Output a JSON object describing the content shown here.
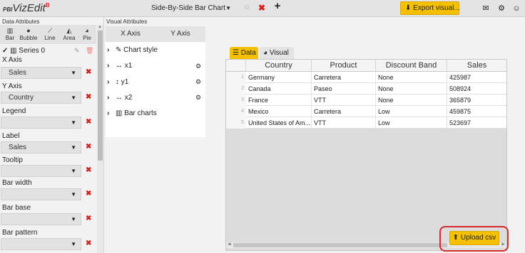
{
  "app": {
    "logo_prefix": "PBI",
    "logo_name": "VizEdit",
    "logo_badge": "B"
  },
  "toolbar": {
    "chart_type_selected": "Side-By-Side Bar Chart",
    "export_label": "Export visual..."
  },
  "data_attributes": {
    "title": "Data Attributes",
    "chart_types": [
      {
        "label": "Bar",
        "icon": "bar-chart-icon"
      },
      {
        "label": "Bubble",
        "icon": "bubble-chart-icon"
      },
      {
        "label": "Line",
        "icon": "line-chart-icon"
      },
      {
        "label": "Area",
        "icon": "area-chart-icon"
      },
      {
        "label": "Pie",
        "icon": "pie-chart-icon"
      }
    ],
    "series_label": "Series 0",
    "fields": [
      {
        "label": "X Axis",
        "value": "Sales"
      },
      {
        "label": "Y Axis",
        "value": "Country"
      },
      {
        "label": "Legend",
        "value": ""
      },
      {
        "label": "Label",
        "value": "Sales"
      },
      {
        "label": "Tooltip",
        "value": ""
      },
      {
        "label": "Bar width",
        "value": ""
      },
      {
        "label": "Bar base",
        "value": ""
      },
      {
        "label": "Bar pattern",
        "value": ""
      }
    ]
  },
  "visual_attributes": {
    "title": "Visual Attributes",
    "tabs": [
      "X Axis",
      "Y Axis"
    ],
    "tree": [
      {
        "label": "Chart style"
      },
      {
        "label": "x1"
      },
      {
        "label": "y1"
      },
      {
        "label": "x2"
      },
      {
        "label": "Bar charts"
      }
    ]
  },
  "data_view": {
    "tabs": [
      "Data",
      "Visual"
    ],
    "columns": [
      "Country",
      "Product",
      "Discount Band",
      "Sales"
    ],
    "rows": [
      {
        "n": "1",
        "cells": [
          "Germany",
          "Carretera",
          "None",
          "425987"
        ]
      },
      {
        "n": "2",
        "cells": [
          "Canada",
          "Paseo",
          "None",
          "508924"
        ]
      },
      {
        "n": "3",
        "cells": [
          "France",
          "VTT",
          "None",
          "365879"
        ]
      },
      {
        "n": "4",
        "cells": [
          "Mexico",
          "Carretera",
          "Low",
          "459875"
        ]
      },
      {
        "n": "5",
        "cells": [
          "United States of Am...",
          "VTT",
          "Low",
          "523697"
        ]
      }
    ],
    "upload_label": "Upload csv"
  },
  "colors": {
    "accent": "#f5c000",
    "danger": "#d62020",
    "highlight": "#d42a2a"
  }
}
